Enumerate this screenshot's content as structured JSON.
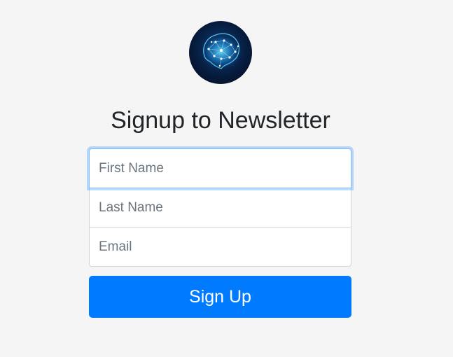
{
  "logo": {
    "icon": "brain-network-icon",
    "accent": "#2fc4ff"
  },
  "heading": "Signup to Newsletter",
  "form": {
    "first_name": {
      "placeholder": "First Name",
      "value": ""
    },
    "last_name": {
      "placeholder": "Last Name",
      "value": ""
    },
    "email": {
      "placeholder": "Email",
      "value": ""
    }
  },
  "submit": {
    "label": "Sign Up"
  },
  "colors": {
    "background": "#f5f5f5",
    "primary": "#007bff",
    "focus_border": "#80bdff"
  }
}
